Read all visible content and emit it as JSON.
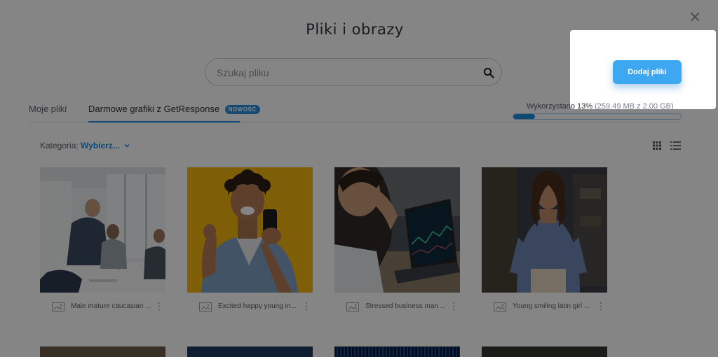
{
  "dialog": {
    "title": "Pliki i obrazy",
    "close_icon": "close-icon"
  },
  "search": {
    "placeholder": "Szukaj pliku",
    "value": ""
  },
  "tabs": [
    {
      "label": "Moje pliki",
      "active": false
    },
    {
      "label": "Darmowe grafiki z GetResponse",
      "active": true,
      "badge": "NOWOŚĆ"
    }
  ],
  "usage": {
    "label": "Wykorzystano 13%",
    "detail": "(259.49 MB z 2.00 GB)",
    "percent": 13
  },
  "filter": {
    "label": "Kategoria:",
    "value": "Wybierz..."
  },
  "view": {
    "grid_icon": "grid-view-icon",
    "list_icon": "list-view-icon"
  },
  "images": [
    {
      "name": "Male mature caucasian ..."
    },
    {
      "name": "Excited happy young in..."
    },
    {
      "name": "Stressed business man ..."
    },
    {
      "name": "Young smiling latin girl ..."
    }
  ],
  "popup": {
    "button_label": "Dodaj pliki"
  },
  "colors": {
    "accent": "#1e8fe1",
    "button": "#3ea7f2",
    "overlay": "rgba(0,0,0,0.48)"
  }
}
